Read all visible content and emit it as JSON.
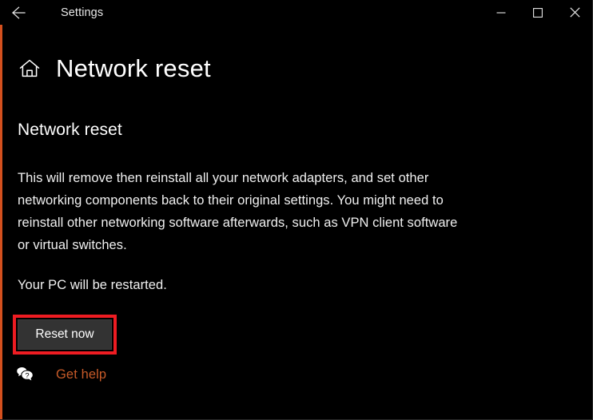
{
  "window": {
    "background_color": "#000000",
    "accent_stripe_color": "#d4501e",
    "titlebar": {
      "app_title": "Settings",
      "back_icon": "back-arrow-icon",
      "controls": [
        {
          "name": "minimize",
          "icon": "minimize-icon",
          "label": "─"
        },
        {
          "name": "maximize",
          "icon": "maximize-icon",
          "label": "□"
        },
        {
          "name": "close",
          "icon": "close-icon",
          "label": "✕"
        }
      ]
    }
  },
  "header": {
    "home_icon": "home-icon",
    "page_title": "Network reset"
  },
  "main": {
    "section_heading": "Network reset",
    "description": "This will remove then reinstall all your network adapters, and set other networking components back to their original settings. You might need to reinstall other networking software afterwards, such as VPN client software or virtual switches.",
    "restart_note": "Your PC will be restarted.",
    "reset_button_label": "Reset now",
    "reset_button_fill": "#333333",
    "annotation_color": "#ee1c22"
  },
  "footer": {
    "get_help_icon": "help-bubble-icon",
    "get_help_label": "Get help",
    "get_help_color": "#c65a28"
  }
}
